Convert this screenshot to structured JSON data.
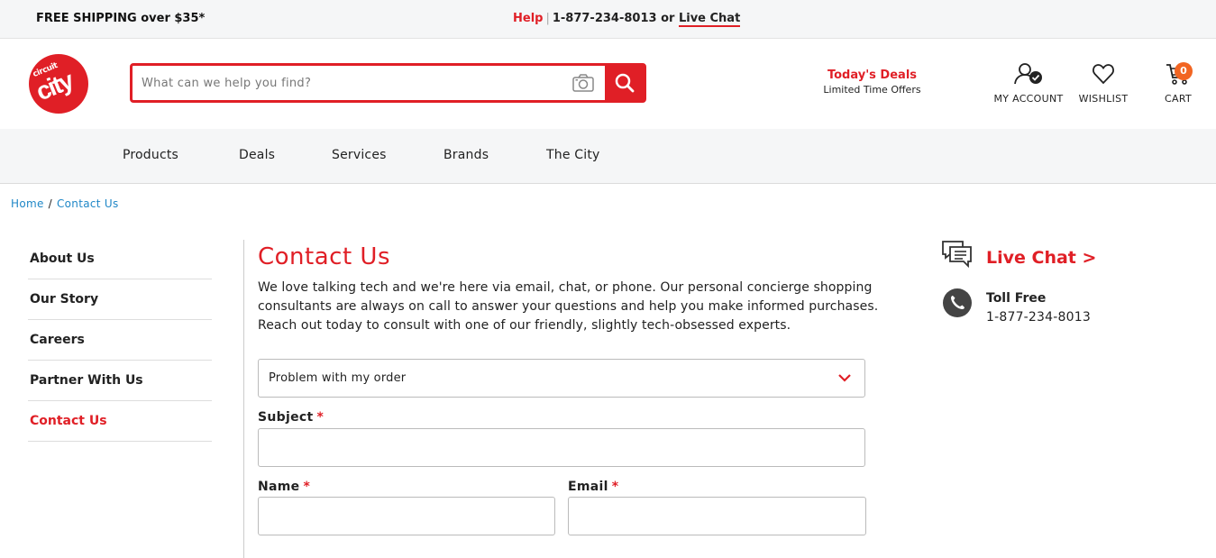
{
  "topbar": {
    "shipping": "FREE SHIPPING over $35*",
    "help": "Help",
    "separator": "|",
    "phone": "1-877-234-8013",
    "or": "or",
    "live_chat": "Live Chat"
  },
  "header": {
    "logo_text_top": "circuit",
    "logo_text_main": "city",
    "search_placeholder": "What can we help you find?",
    "deals_title": "Today's Deals",
    "deals_subtitle": "Limited Time Offers",
    "account_label": "MY ACCOUNT",
    "wishlist_label": "WISHLIST",
    "cart_label": "CART",
    "cart_count": "0"
  },
  "nav": {
    "items": [
      "Products",
      "Deals",
      "Services",
      "Brands",
      "The City"
    ]
  },
  "breadcrumb": {
    "home": "Home",
    "separator": "/",
    "current": "Contact Us"
  },
  "sidebar": {
    "items": [
      "About Us",
      "Our Story",
      "Careers",
      "Partner With Us",
      "Contact Us"
    ],
    "active": "Contact Us"
  },
  "main": {
    "title": "Contact Us",
    "intro": "We love talking tech and we're here via email, chat, or phone. Our personal concierge shopping consultants are always on call to answer your questions and help you make informed purchases. Reach out today to consult with one of our friendly, slightly tech-obsessed experts.",
    "topic_selected": "Problem with my order",
    "subject_label": "Subject",
    "name_label": "Name",
    "email_label": "Email",
    "required_mark": "*"
  },
  "contact_panel": {
    "live_chat": "Live Chat >",
    "toll_free_label": "Toll Free",
    "toll_free_number": "1-877-234-8013"
  },
  "colors": {
    "brand_red": "#e01f26",
    "link_blue": "#1f87c7",
    "badge_orange": "#f26522"
  }
}
